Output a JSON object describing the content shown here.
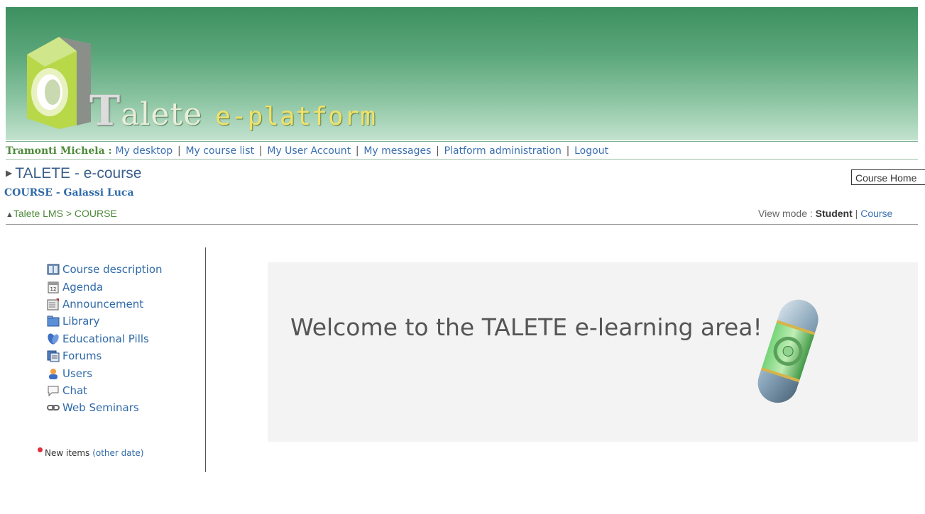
{
  "header": {
    "brand_letter": "T",
    "brand_rest": "alete",
    "brand_suffix": "e-platform"
  },
  "navbar": {
    "user_name": "Tramonti Michela :",
    "links": [
      "My desktop",
      "My course list",
      "My User Account",
      "My messages",
      "Platform administration",
      "Logout"
    ],
    "separator": "|"
  },
  "course": {
    "title": "TALETE - e-course",
    "subtitle": "COURSE - Galassi Luca",
    "home_box": "Course Home"
  },
  "breadcrumb": {
    "root": "Talete LMS",
    "separator": ">",
    "current": "COURSE"
  },
  "view_mode": {
    "label": "View mode :",
    "active": "Student",
    "separator": "|",
    "other": "Course"
  },
  "menu": {
    "items": [
      {
        "label": "Course description",
        "icon": "course-description-icon"
      },
      {
        "label": "Agenda",
        "icon": "calendar-icon"
      },
      {
        "label": "Announcement",
        "icon": "announcement-icon"
      },
      {
        "label": "Library",
        "icon": "folder-icon"
      },
      {
        "label": "Educational Pills",
        "icon": "pill-icon"
      },
      {
        "label": "Forums",
        "icon": "forum-icon"
      },
      {
        "label": "Users",
        "icon": "users-icon"
      },
      {
        "label": "Chat",
        "icon": "chat-icon"
      },
      {
        "label": "Web Seminars",
        "icon": "link-icon"
      }
    ]
  },
  "legend": {
    "text": "New items",
    "link": "(other date)"
  },
  "welcome": {
    "message": "Welcome to the TALETE e-learning area!"
  },
  "colors": {
    "banner_top": "#3d9060",
    "banner_bottom": "#c3e2cf",
    "link": "#2f6aa8",
    "green_text": "#4d8a3a",
    "new_dot": "#e03040"
  }
}
